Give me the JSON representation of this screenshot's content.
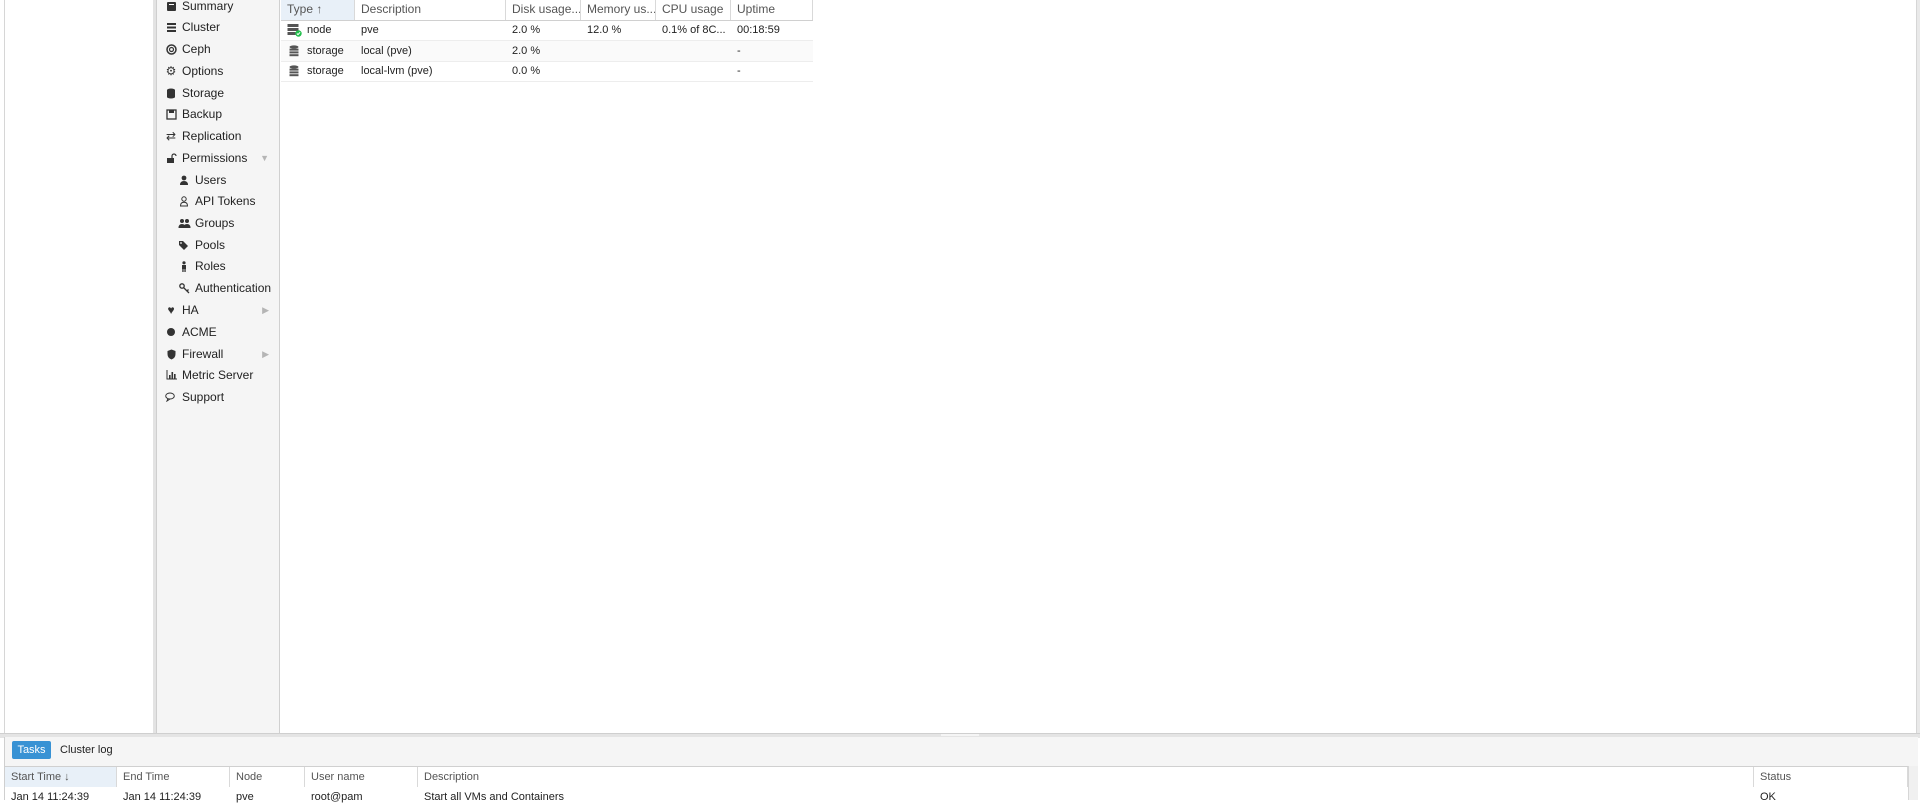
{
  "nav": {
    "items": [
      {
        "label": "Summary",
        "icon": "book-icon"
      },
      {
        "label": "Cluster",
        "icon": "server-list-icon"
      },
      {
        "label": "Ceph",
        "icon": "ceph-icon"
      },
      {
        "label": "Options",
        "icon": "gear-icon"
      },
      {
        "label": "Storage",
        "icon": "database-icon"
      },
      {
        "label": "Backup",
        "icon": "floppy-icon"
      },
      {
        "label": "Replication",
        "icon": "retweet-icon"
      },
      {
        "label": "Permissions",
        "icon": "unlock-icon",
        "expanded": true
      },
      {
        "label": "Users",
        "icon": "user-icon"
      },
      {
        "label": "API Tokens",
        "icon": "user-outline-icon"
      },
      {
        "label": "Groups",
        "icon": "users-icon"
      },
      {
        "label": "Pools",
        "icon": "tags-icon"
      },
      {
        "label": "Roles",
        "icon": "male-icon"
      },
      {
        "label": "Authentication",
        "icon": "key-icon"
      },
      {
        "label": "HA",
        "icon": "heartbeat-icon",
        "collapsed": true
      },
      {
        "label": "ACME",
        "icon": "certificate-icon"
      },
      {
        "label": "Firewall",
        "icon": "shield-icon",
        "collapsed": true
      },
      {
        "label": "Metric Server",
        "icon": "bar-chart-icon"
      },
      {
        "label": "Support",
        "icon": "comments-icon"
      }
    ]
  },
  "grid": {
    "columns": [
      "Type ↑",
      "Description",
      "Disk usage...",
      "Memory us...",
      "CPU usage",
      "Uptime"
    ],
    "rows": [
      {
        "type": "node",
        "icon": "node-online-icon",
        "description": "pve",
        "disk": "2.0 %",
        "memory": "12.0 %",
        "cpu": "0.1% of 8C...",
        "uptime": "00:18:59"
      },
      {
        "type": "storage",
        "icon": "storage-icon",
        "description": "local (pve)",
        "disk": "2.0 %",
        "memory": "",
        "cpu": "",
        "uptime": "-"
      },
      {
        "type": "storage",
        "icon": "storage-icon",
        "description": "local-lvm (pve)",
        "disk": "0.0 %",
        "memory": "",
        "cpu": "",
        "uptime": "-"
      }
    ]
  },
  "bottom": {
    "tabs": {
      "tasks": "Tasks",
      "cluster_log": "Cluster log"
    },
    "columns": [
      "Start Time ↓",
      "End Time",
      "Node",
      "User name",
      "Description",
      "Status"
    ],
    "rows": [
      {
        "start": "Jan 14 11:24:39",
        "end": "Jan 14 11:24:39",
        "node": "pve",
        "user": "root@pam",
        "description": "Start all VMs and Containers",
        "status": "OK"
      }
    ]
  },
  "colors": {
    "accent": "#3892d4",
    "nav_bg": "#f5f5f5",
    "sorted_header": "#e8f0f8"
  }
}
